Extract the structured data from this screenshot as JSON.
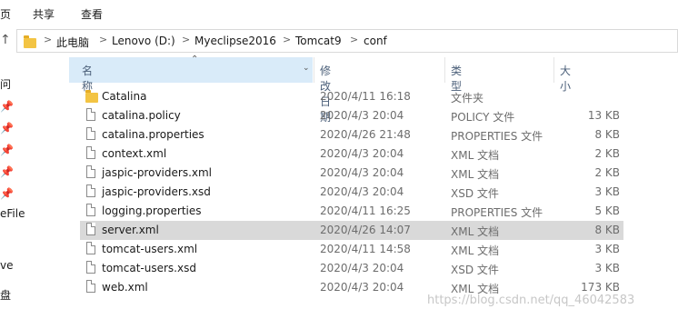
{
  "ribbon": {
    "tabs": [
      "页",
      "共享",
      "查看"
    ]
  },
  "address": {
    "crumbs": [
      "此电脑",
      "Lenovo (D:)",
      "Myeclipse2016",
      "Tomcat9",
      "conf"
    ],
    "separator": ">"
  },
  "nav": {
    "items": [
      "问",
      "eFile",
      "ve",
      "盘"
    ],
    "pins": [
      "📌",
      "📌",
      "📌",
      "📌",
      "📌"
    ]
  },
  "columns": {
    "name": "名称",
    "date": "修改日期",
    "type": "类型",
    "size": "大小"
  },
  "files": [
    {
      "name": "Catalina",
      "date": "2020/4/11 16:18",
      "type": "文件夹",
      "size": "",
      "icon": "folder-icon"
    },
    {
      "name": "catalina.policy",
      "date": "2020/4/3 20:04",
      "type": "POLICY 文件",
      "size": "13 KB",
      "icon": "file-icon"
    },
    {
      "name": "catalina.properties",
      "date": "2020/4/26 21:48",
      "type": "PROPERTIES 文件",
      "size": "8 KB",
      "icon": "file-icon"
    },
    {
      "name": "context.xml",
      "date": "2020/4/3 20:04",
      "type": "XML 文档",
      "size": "2 KB",
      "icon": "file-icon"
    },
    {
      "name": "jaspic-providers.xml",
      "date": "2020/4/3 20:04",
      "type": "XML 文档",
      "size": "2 KB",
      "icon": "file-icon"
    },
    {
      "name": "jaspic-providers.xsd",
      "date": "2020/4/3 20:04",
      "type": "XSD 文件",
      "size": "3 KB",
      "icon": "file-icon"
    },
    {
      "name": "logging.properties",
      "date": "2020/4/11 16:25",
      "type": "PROPERTIES 文件",
      "size": "5 KB",
      "icon": "file-icon"
    },
    {
      "name": "server.xml",
      "date": "2020/4/26 14:07",
      "type": "XML 文档",
      "size": "8 KB",
      "icon": "file-icon",
      "selected": true
    },
    {
      "name": "tomcat-users.xml",
      "date": "2020/4/11 14:58",
      "type": "XML 文档",
      "size": "3 KB",
      "icon": "file-icon"
    },
    {
      "name": "tomcat-users.xsd",
      "date": "2020/4/3 20:04",
      "type": "XSD 文件",
      "size": "3 KB",
      "icon": "file-icon"
    },
    {
      "name": "web.xml",
      "date": "2020/4/3 20:04",
      "type": "XML 文档",
      "size": "173 KB",
      "icon": "file-icon"
    }
  ],
  "watermark": "https://blog.csdn.net/qq_46042583",
  "colors": {
    "selected_row": "#d9d9d9",
    "header_text": "#4c607a",
    "folder": "#f3c443"
  }
}
